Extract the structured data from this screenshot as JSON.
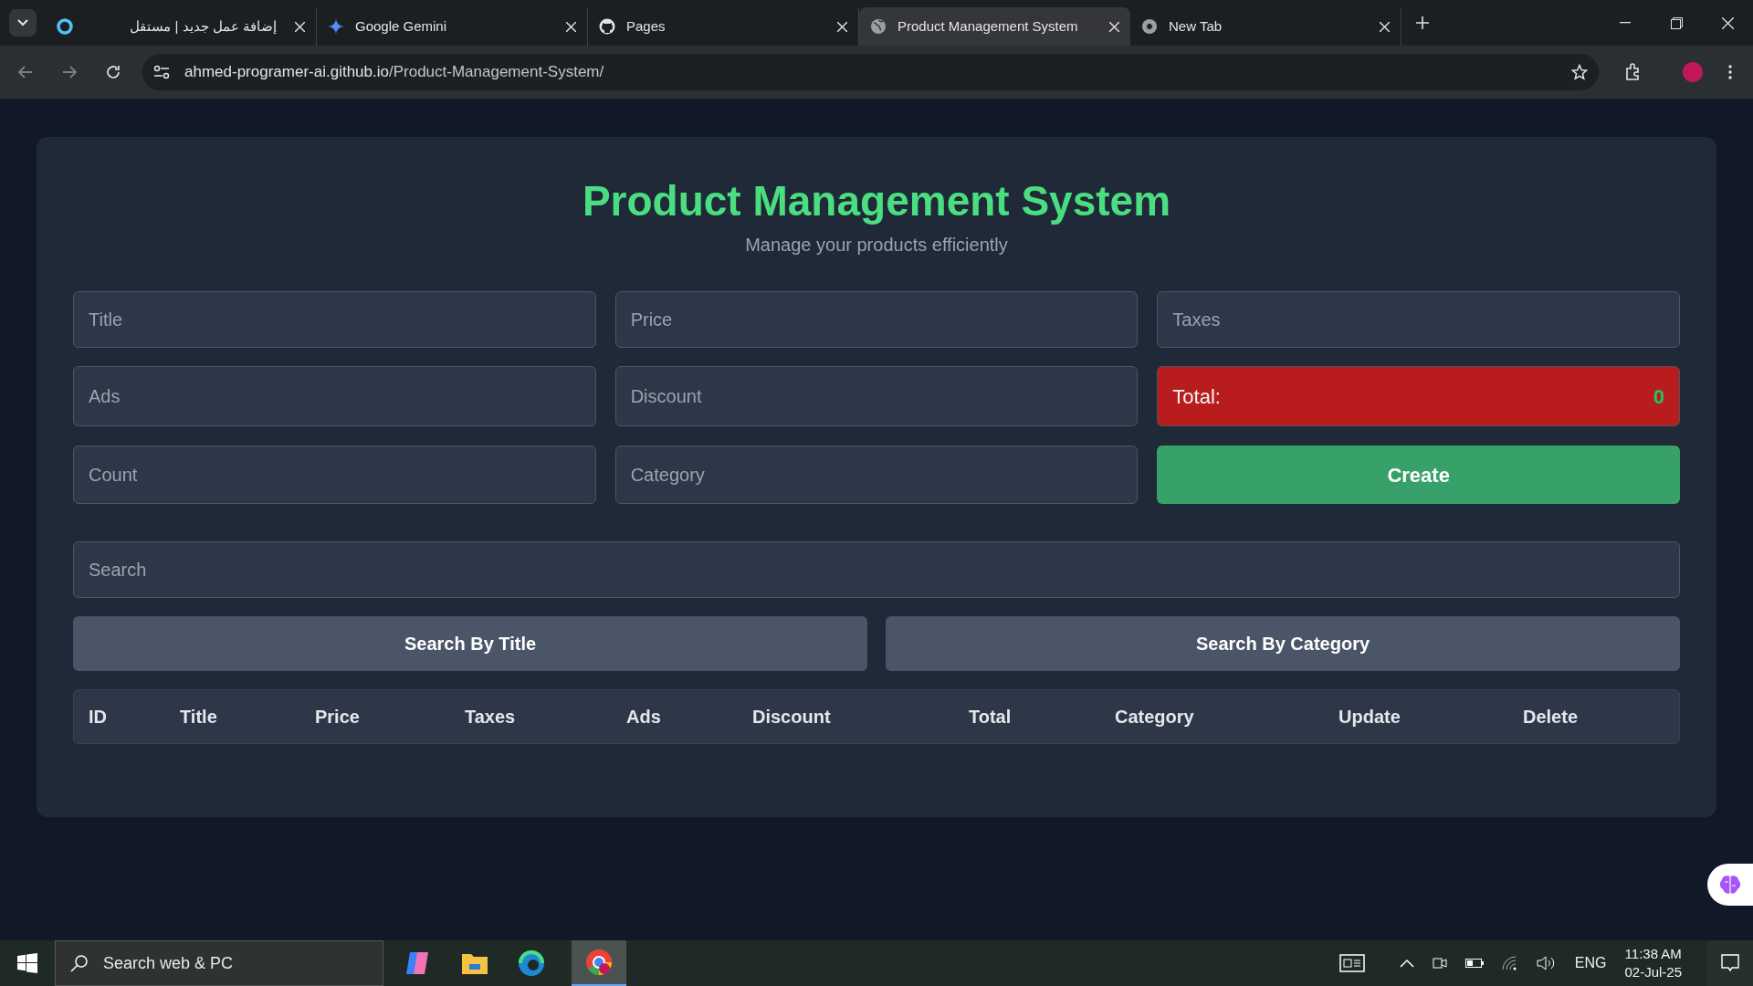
{
  "browser": {
    "tabs": [
      {
        "title": "إضافة عمل جديد | مستقل",
        "selected": false
      },
      {
        "title": "Google Gemini",
        "selected": false
      },
      {
        "title": "Pages",
        "selected": false
      },
      {
        "title": "Product Management System",
        "selected": true
      },
      {
        "title": "New Tab",
        "selected": false
      }
    ],
    "address": {
      "host": "ahmed-programer-ai.github.io",
      "path": "/Product-Management-System/"
    }
  },
  "page": {
    "title": "Product Management System",
    "subtitle": "Manage your products efficiently",
    "form": [
      {
        "kind": "input",
        "placeholder": "Title"
      },
      {
        "kind": "input",
        "placeholder": "Price"
      },
      {
        "kind": "input",
        "placeholder": "Taxes"
      },
      {
        "kind": "input",
        "placeholder": "Ads"
      },
      {
        "kind": "input",
        "placeholder": "Discount"
      },
      {
        "kind": "total",
        "label": "Total:",
        "value": "0"
      },
      {
        "kind": "input",
        "placeholder": "Count"
      },
      {
        "kind": "input",
        "placeholder": "Category"
      },
      {
        "kind": "button",
        "label": "Create"
      }
    ],
    "search": {
      "placeholder": "Search"
    },
    "search_buttons": [
      "Search By Title",
      "Search By Category"
    ],
    "table": {
      "columns": [
        "ID",
        "Title",
        "Price",
        "Taxes",
        "Ads",
        "Discount",
        "Total",
        "Category",
        "Update",
        "Delete"
      ]
    }
  },
  "taskbar": {
    "search": "Search web & PC",
    "language": "ENG",
    "time": "11:38 AM",
    "date": "02-Jul-25"
  }
}
